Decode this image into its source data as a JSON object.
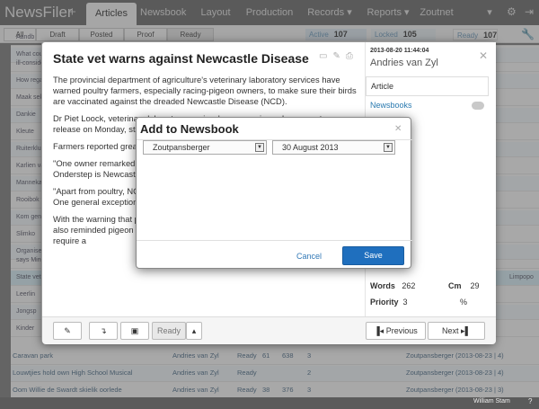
{
  "nav": {
    "brand": "NewsFiler",
    "tabs": [
      "Articles",
      "Newsbook",
      "Layout",
      "Production",
      "Records ▾",
      "Reports ▾",
      "Zoutnet",
      "▾"
    ]
  },
  "subbar": {
    "tabs": [
      "All",
      "Draft",
      "Posted",
      "Proof",
      "Ready"
    ],
    "active_label": "Active",
    "active_count": "107",
    "locked_label": "Locked",
    "locked_count": "105",
    "ready_label": "Ready",
    "ready_count": "107"
  },
  "bg_rows": [
    [
      "Aandb",
      ""
    ],
    [
      "What could",
      ""
    ],
    [
      "ill-conside",
      ""
    ],
    [
      "How regard",
      ""
    ],
    [
      "Maak seke",
      ""
    ],
    [
      "Dankie",
      ""
    ],
    [
      "Kleute",
      ""
    ],
    [
      "Ruiterklub",
      ""
    ],
    [
      "Karlien va",
      ""
    ],
    [
      "Mannekan",
      ""
    ],
    [
      "Rooibok fo",
      ""
    ],
    [
      "Kom geno",
      ""
    ],
    [
      "Slimko",
      ""
    ],
    [
      "Organisers",
      ""
    ],
    [
      "says Minist",
      ""
    ],
    [
      "State vet w",
      "Limpopo"
    ],
    [
      "Leerlin",
      ""
    ],
    [
      "Jongsp",
      ""
    ],
    [
      "Kinder",
      ""
    ]
  ],
  "bottom_rows": [
    {
      "title": "Caravan park",
      "author": "Andries van Zyl",
      "status": "Ready",
      "a": "61",
      "b": "638",
      "c": "3",
      "book": "Zoutpansberger (2013-08-23 | 4)"
    },
    {
      "title": "Louwtjies hold own High School Musical",
      "author": "Andries van Zyl",
      "status": "Ready",
      "a": "",
      "b": "",
      "c": "2",
      "book": "Zoutpansberger (2013-08-23 | 4)"
    },
    {
      "title": "Oom Willie de Swardt skielik oorlede",
      "author": "Andries van Zyl",
      "status": "Ready",
      "a": "38",
      "b": "376",
      "c": "3",
      "book": "Zoutpansberger (2013-08-23 | 3)"
    }
  ],
  "article": {
    "title": "State vet warns against Newcastle Disease",
    "paragraphs": [
      "The provincial department of agriculture's veterinary laboratory services have warned poultry farmers, especially racing-pigeon owners, to make sure their birds are vaccinated against the dreaded Newcastle Disease (NCD).",
      "Dr Piet Loock, veterinary laboratory services' manager, issued an urgent press release on Monday, stating that th phenomenon around th",
      "Farmers reported great very lethargic, partly pa where they sat on the",
      "\"One owner remarked t or on the roads and the cars,\" says Loock. Ne (NCD). The Onderstep is Newcastle disease)",
      "\"Apart from poultry, NC partridges, etc. Tame p also susceptible but m symptoms. One general exception is cockatiels, which can also die acutely,\" says Loock.",
      "With the warning that poultry farmers should have their birds vaccinated, Loock also reminded pigeon owners that certain commercial NCD vaccines for pigeons require a"
    ]
  },
  "side": {
    "date": "2013-08-20 11:44:04",
    "author": "Andries van Zyl",
    "type": "Article",
    "newsbooks_label": "Newsbooks",
    "newsbooks_count": "1",
    "words_label": "Words",
    "words": "262",
    "cm_label": "Cm",
    "cm": "29",
    "priority_label": "Priority",
    "priority": "3",
    "pct": "%"
  },
  "footer": {
    "status": "Ready",
    "prev": "Previous",
    "next": "Next"
  },
  "dialog": {
    "title": "Add to Newsbook",
    "newsbook": "Zoutpansberger",
    "date": "30 August 2013",
    "cancel": "Cancel",
    "save": "Save"
  },
  "status_bar": {
    "user": "William Stam",
    "help": "?"
  }
}
